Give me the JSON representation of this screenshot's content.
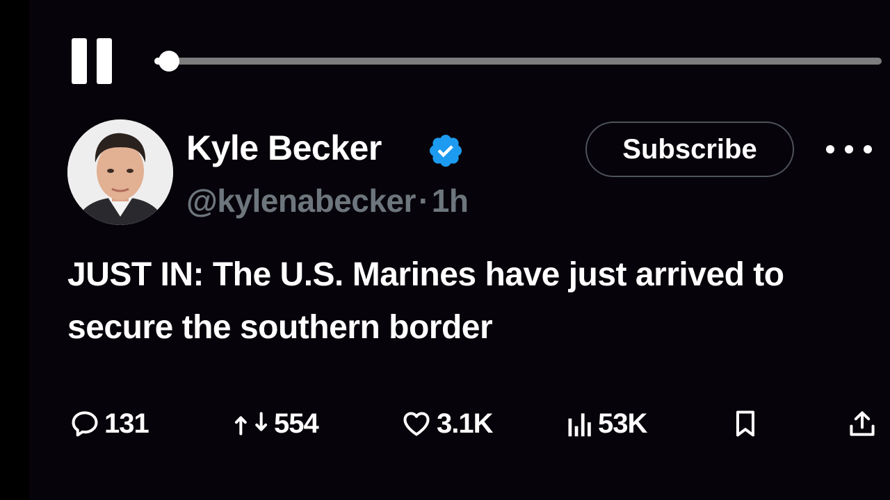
{
  "player": {
    "progress_percent": 2
  },
  "tweet": {
    "display_name": "Kyle Becker",
    "handle": "@kylenabecker",
    "separator": "·",
    "time_ago": "1h",
    "subscribe_label": "Subscribe",
    "text": "JUST IN: The U.S. Marines have just arrived to secure the southern border",
    "verified_color": "#1d9bf0"
  },
  "actions": {
    "replies": "131",
    "reposts": "554",
    "likes": "3.1K",
    "views": "53K"
  },
  "icons": {
    "pause": "pause-icon",
    "verified": "verified-badge-icon",
    "more": "more-options-icon",
    "reply": "reply-icon",
    "repost": "repost-icon",
    "like": "heart-icon",
    "views": "views-chart-icon",
    "bookmark": "bookmark-icon",
    "share": "share-icon"
  },
  "colors": {
    "background": "#07030a",
    "secondary_text": "#6e767d",
    "track": "#7d7d7d"
  }
}
